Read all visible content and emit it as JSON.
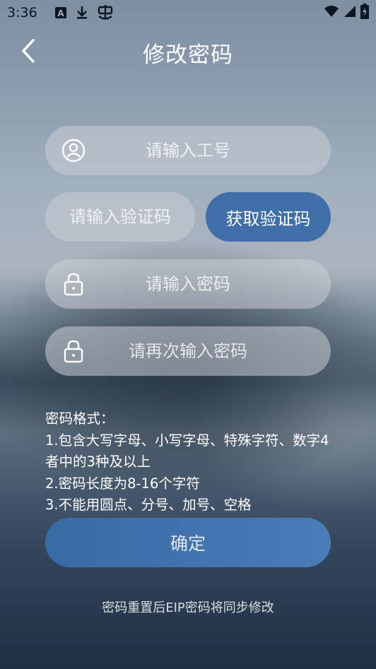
{
  "status_bar": {
    "time": "3:36",
    "left_icons": [
      "notification-a-icon",
      "download-icon",
      "bug-icon"
    ],
    "right_icons": [
      "wifi-icon",
      "cellular-signal-icon",
      "battery-charging-icon"
    ]
  },
  "header": {
    "title": "修改密码",
    "back_icon": "chevron-left-icon"
  },
  "form": {
    "employee_id": {
      "placeholder": "请输入工号",
      "value": "",
      "icon": "user-icon"
    },
    "verification_code": {
      "placeholder": "请输入验证码",
      "value": ""
    },
    "get_code_label": "获取验证码",
    "password": {
      "placeholder": "请输入密码",
      "value": "",
      "icon": "lock-icon"
    },
    "confirm_password": {
      "placeholder": "请再次输入密码",
      "value": "",
      "icon": "lock-icon"
    }
  },
  "rules": {
    "title": "密码格式：",
    "items": [
      "1.包含大写字母、小写字母、特殊字符、数字4者中的3种及以上",
      "2.密码长度为8-16个字符",
      "3.不能用圆点、分号、加号、空格"
    ]
  },
  "confirm_label": "确定",
  "footer_note": "密码重置后EIP密码将同步修改",
  "colors": {
    "primary_button": "#3f6ea8",
    "input_background": "#c8ced6",
    "text": "#ffffff"
  }
}
